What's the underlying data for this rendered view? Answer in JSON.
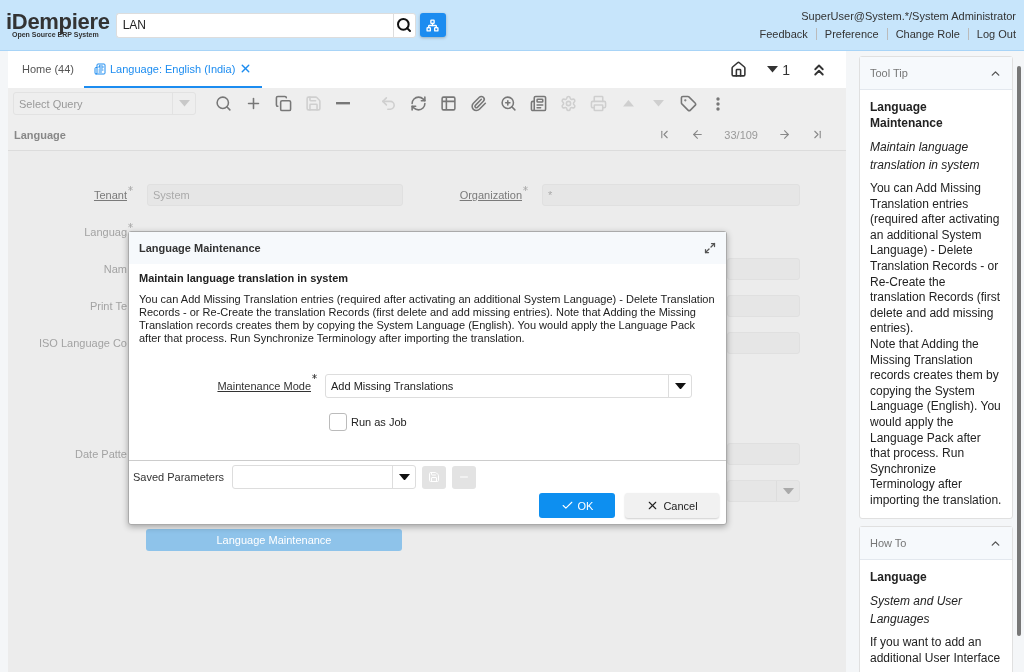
{
  "header": {
    "logo": "iDempiere",
    "logo_tagline": "Open Source ERP System",
    "search": {
      "value": "LAN"
    },
    "user": "SuperUser@System.*/System Administrator",
    "links": [
      "Feedback",
      "Preference",
      "Change Role",
      "Log Out"
    ]
  },
  "tabs": [
    {
      "label": "Home (44)",
      "selected": false,
      "closable": false
    },
    {
      "label": "Language: English (India)",
      "selected": true,
      "closable": true
    }
  ],
  "tab_actions": {
    "count": "1"
  },
  "toolbar": {
    "query": {
      "placeholder": "Select Query"
    },
    "record_buttons": [
      {
        "kind": "search",
        "disabled": false
      },
      {
        "kind": "new",
        "disabled": false
      },
      {
        "kind": "copy",
        "disabled": false
      },
      {
        "kind": "save",
        "disabled": true
      },
      {
        "kind": "delete",
        "disabled": false
      }
    ],
    "action_buttons": [
      {
        "kind": "undo",
        "disabled": true
      },
      {
        "kind": "refresh",
        "disabled": false
      },
      {
        "kind": "grid",
        "disabled": false
      },
      {
        "kind": "attach",
        "disabled": false
      },
      {
        "kind": "zoom",
        "disabled": false
      },
      {
        "kind": "report",
        "disabled": false
      },
      {
        "kind": "settings",
        "disabled": true
      },
      {
        "kind": "print",
        "disabled": true
      },
      {
        "kind": "up",
        "disabled": true
      },
      {
        "kind": "down",
        "disabled": true
      },
      {
        "kind": "tag",
        "disabled": false
      },
      {
        "kind": "more",
        "disabled": false
      }
    ]
  },
  "record_nav": {
    "title": "Language",
    "position": "33/109"
  },
  "form": {
    "rows": [
      {
        "label": "Tenant",
        "linked": true,
        "required": true,
        "value": "System",
        "right": {
          "kind": "field",
          "label": "Organization",
          "linked": true,
          "required": true,
          "value": "*"
        }
      },
      {
        "label": "Languag",
        "linked": false,
        "required": true,
        "right": {
          "kind": "none"
        }
      },
      {
        "label": "Nam",
        "linked": false,
        "right": {
          "kind": "field"
        }
      },
      {
        "label": "Print Te",
        "linked": false,
        "right": {
          "kind": "field"
        }
      },
      {
        "label": "ISO Language Co",
        "linked": false,
        "right": {
          "kind": "field"
        }
      },
      {
        "label": "Date Patte",
        "linked": false,
        "right": {
          "kind": "field"
        }
      },
      {
        "right": {
          "kind": "select"
        }
      }
    ],
    "action_button": "Language Maintenance"
  },
  "dialog": {
    "title": "Language Maintenance",
    "heading": "Maintain language translation in system",
    "description": "You can Add Missing Translation entries (required after activating an additional System Language) - Delete Translation Records - or Re-Create the translation Records (first delete and add missing entries). Note that Adding the Missing Translation records creates them by copying the System Language (English). You would apply the Language Pack after that process. Run Synchronize Terminology after importing the translation.",
    "mode": {
      "label": "Maintenance Mode",
      "required": true,
      "value": "Add Missing Translations"
    },
    "run_as_job": {
      "label": "Run as Job",
      "checked": false
    },
    "saved_parameters": {
      "label": "Saved Parameters",
      "save_disabled": true,
      "delete_disabled": true
    },
    "buttons": [
      {
        "kind": "ok",
        "label": "OK"
      },
      {
        "kind": "cancel",
        "label": "Cancel"
      }
    ]
  },
  "side_panel": [
    {
      "title": "Tool Tip",
      "expanded": true,
      "name": "Language Maintenance",
      "summary": "Maintain language translation in system",
      "text": "You can Add Missing Translation entries (required after activating an additional System Language) - Delete Translation Records - or Re-Create the translation Records (first delete and add missing entries).\nNote that Adding the Missing Translation records creates them by copying the System Language (English). You would apply the Language Pack after that process. Run Synchronize Terminology after importing the translation."
    },
    {
      "title": "How To",
      "expanded": true,
      "name": "Language",
      "summary": "System and User Languages",
      "text": "If you want to add an additional User Interface"
    }
  ]
}
